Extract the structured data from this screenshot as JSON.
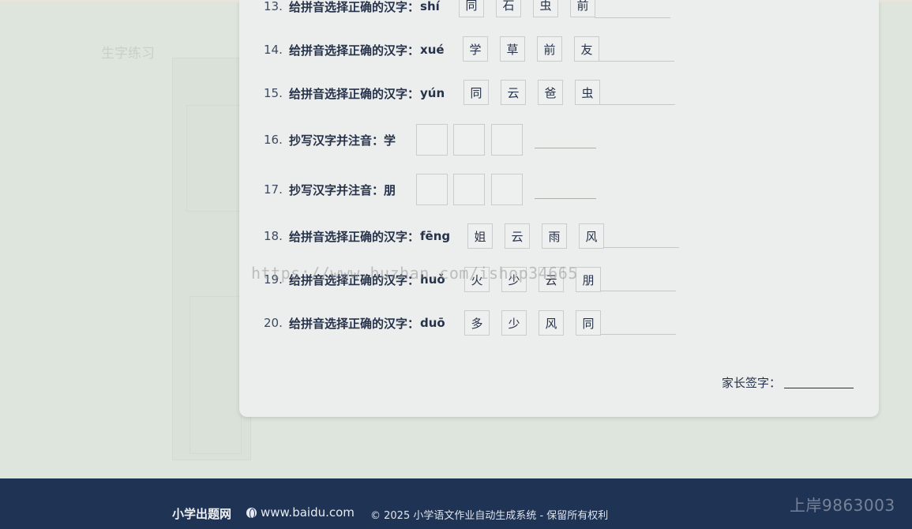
{
  "background": {
    "title": "生字练习"
  },
  "questions": [
    {
      "num": "13.",
      "text": "给拼音选择正确的汉字：",
      "pinyin": "shí",
      "options": [
        "同",
        "石",
        "虫",
        "前"
      ]
    },
    {
      "num": "14.",
      "text": "给拼音选择正确的汉字：",
      "pinyin": "xué",
      "options": [
        "学",
        "草",
        "前",
        "友"
      ]
    },
    {
      "num": "15.",
      "text": "给拼音选择正确的汉字：",
      "pinyin": "yún",
      "options": [
        "同",
        "云",
        "爸",
        "虫"
      ]
    },
    {
      "num": "16.",
      "text": "抄写汉字并注音：学"
    },
    {
      "num": "17.",
      "text": "抄写汉字并注音：朋"
    },
    {
      "num": "18.",
      "text": "给拼音选择正确的汉字：",
      "pinyin": "fēng",
      "options": [
        "姐",
        "云",
        "雨",
        "风"
      ]
    },
    {
      "num": "19.",
      "text": "给拼音选择正确的汉字：",
      "pinyin": "huǒ",
      "options": [
        "火",
        "少",
        "云",
        "朋"
      ]
    },
    {
      "num": "20.",
      "text": "给拼音选择正确的汉字：",
      "pinyin": "duō",
      "options": [
        "多",
        "少",
        "风",
        "同"
      ]
    }
  ],
  "signature": {
    "label": "家长签字："
  },
  "watermark": "https://www.huzhan.com/ishop34665",
  "footer": {
    "brand": "小学出题网",
    "site": "www.baidu.com",
    "copyright": "© 2025 小学语文作业自动生成系统 - 保留所有权利",
    "corner_mark": "上岸9863003"
  }
}
